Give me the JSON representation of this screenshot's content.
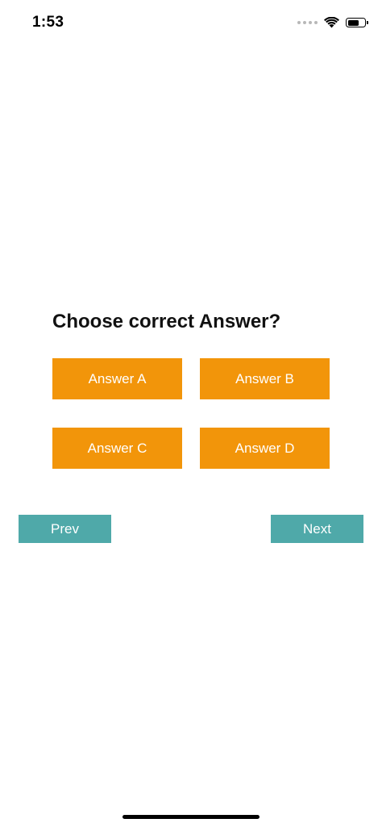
{
  "status_bar": {
    "time": "1:53",
    "signal_icon": "signal-dots-icon",
    "wifi_icon": "wifi-icon",
    "battery_icon": "battery-icon",
    "battery_level": 0.65
  },
  "question": {
    "text": "Choose correct Answer?"
  },
  "answers": [
    {
      "label": "Answer A"
    },
    {
      "label": "Answer B"
    },
    {
      "label": "Answer C"
    },
    {
      "label": "Answer D"
    }
  ],
  "navigation": {
    "prev_label": "Prev",
    "next_label": "Next"
  },
  "colors": {
    "answer_button": "#f2950a",
    "nav_button": "#4fa9a9",
    "background": "#ffffff"
  }
}
